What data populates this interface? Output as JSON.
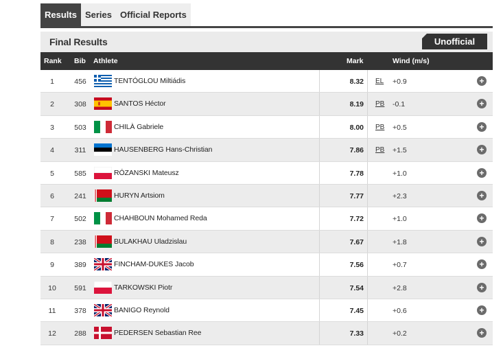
{
  "tabs": [
    {
      "label": "Results",
      "active": true
    },
    {
      "label": "Series",
      "active": false
    },
    {
      "label": "Official Reports",
      "active": false
    }
  ],
  "header": {
    "title": "Final Results",
    "status": "Unofficial"
  },
  "columns": {
    "rank": "Rank",
    "bib": "Bib",
    "athlete": "Athlete",
    "mark": "Mark",
    "wind": "Wind (m/s)"
  },
  "results": [
    {
      "rank": "1",
      "bib": "456",
      "country": "GRE",
      "athlete": "TENTÓGLOU Miltiádis",
      "mark": "8.32",
      "record": "EL",
      "wind": "+0.9"
    },
    {
      "rank": "2",
      "bib": "308",
      "country": "ESP",
      "athlete": "SANTOS Héctor",
      "mark": "8.19",
      "record": "PB",
      "wind": "-0.1"
    },
    {
      "rank": "3",
      "bib": "503",
      "country": "ITA",
      "athlete": "CHILÀ Gabriele",
      "mark": "8.00",
      "record": "PB",
      "wind": "+0.5"
    },
    {
      "rank": "4",
      "bib": "311",
      "country": "EST",
      "athlete": "HAUSENBERG Hans-Christian",
      "mark": "7.86",
      "record": "PB",
      "wind": "+1.5"
    },
    {
      "rank": "5",
      "bib": "585",
      "country": "POL",
      "athlete": "RÓZANSKI Mateusz",
      "mark": "7.78",
      "record": "",
      "wind": "+1.0"
    },
    {
      "rank": "6",
      "bib": "241",
      "country": "BLR",
      "athlete": "HURYN Artsiom",
      "mark": "7.77",
      "record": "",
      "wind": "+2.3"
    },
    {
      "rank": "7",
      "bib": "502",
      "country": "ITA",
      "athlete": "CHAHBOUN Mohamed Reda",
      "mark": "7.72",
      "record": "",
      "wind": "+1.0"
    },
    {
      "rank": "8",
      "bib": "238",
      "country": "BLR",
      "athlete": "BULAKHAU Uladzislau",
      "mark": "7.67",
      "record": "",
      "wind": "+1.8"
    },
    {
      "rank": "9",
      "bib": "389",
      "country": "GBR",
      "athlete": "FINCHAM-DUKES Jacob",
      "mark": "7.56",
      "record": "",
      "wind": "+0.7"
    },
    {
      "rank": "10",
      "bib": "591",
      "country": "POL",
      "athlete": "TARKOWSKI Piotr",
      "mark": "7.54",
      "record": "",
      "wind": "+2.8"
    },
    {
      "rank": "11",
      "bib": "378",
      "country": "GBR",
      "athlete": "BANIGO Reynold",
      "mark": "7.45",
      "record": "",
      "wind": "+0.6"
    },
    {
      "rank": "12",
      "bib": "288",
      "country": "DEN",
      "athlete": "PEDERSEN Sebastian Ree",
      "mark": "7.33",
      "record": "",
      "wind": "+0.2"
    }
  ],
  "expand_icon": "plus-circle-icon",
  "colors": {
    "dark": "#333333",
    "header_bg": "#ebebeb",
    "row_alt": "#ececec",
    "icon": "#6b6b6b"
  }
}
